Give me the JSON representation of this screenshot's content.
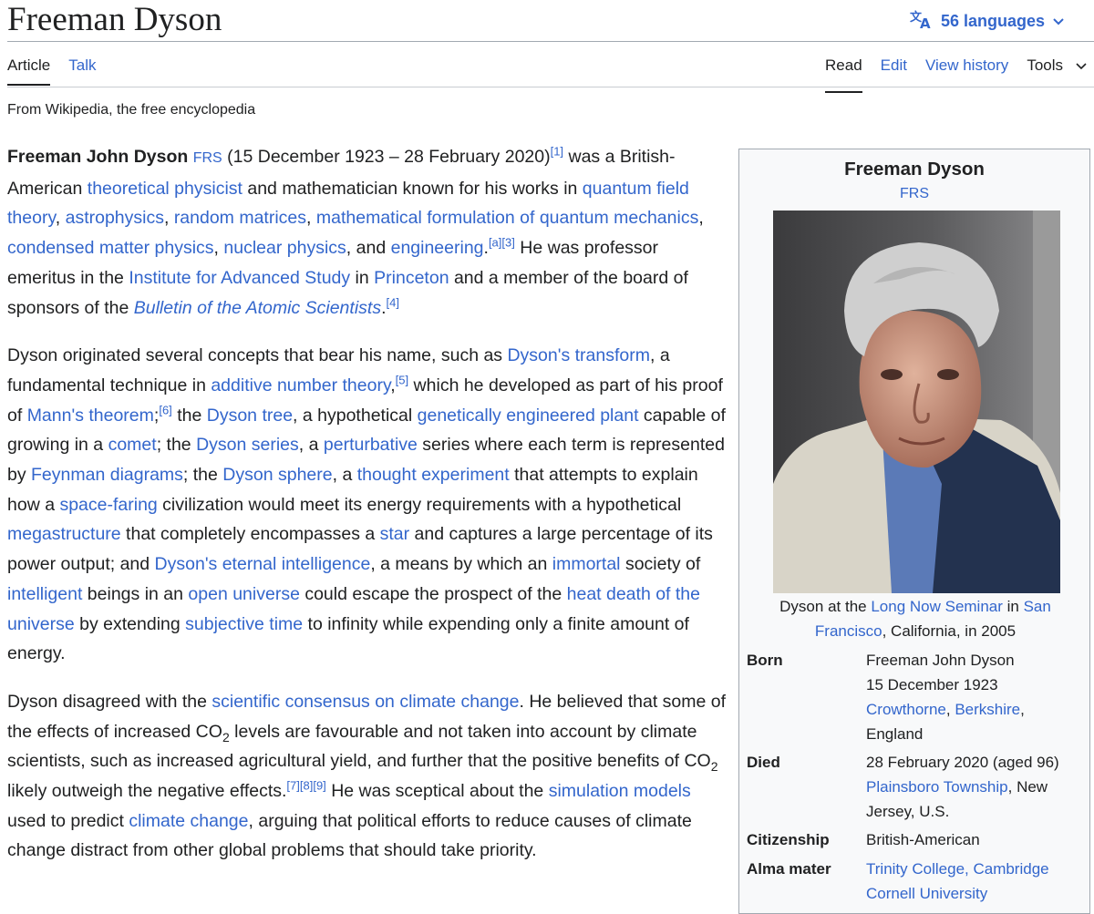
{
  "page": {
    "title": "Freeman Dyson",
    "languages_label": "56 languages",
    "tagline": "From Wikipedia, the free encyclopedia"
  },
  "tabs": {
    "article": "Article",
    "talk": "Talk",
    "read": "Read",
    "edit": "Edit",
    "view_history": "View history",
    "tools": "Tools"
  },
  "infobox": {
    "name": "Freeman Dyson",
    "post_nominal": "FRS",
    "caption": {
      "t1": "Dyson at the ",
      "l1": "Long Now Seminar",
      "t2": " in ",
      "l2": "San Francisco",
      "t3": ", California, in 2005"
    },
    "born": {
      "label": "Born",
      "name": "Freeman John Dyson",
      "date": "15 December 1923",
      "place1": "Crowthorne",
      "sep": ", ",
      "place2": "Berkshire",
      "place3": "England"
    },
    "died": {
      "label": "Died",
      "date": "28 February 2020 (aged 96)",
      "place1": "Plainsboro Township",
      "place1_rest": ", New Jersey, U.S."
    },
    "citizenship": {
      "label": "Citizenship",
      "value": "British-American"
    },
    "alma_mater": {
      "label": "Alma mater",
      "v1": "Trinity College, Cambridge",
      "v2": "Cornell University"
    }
  },
  "content": {
    "p1": [
      {
        "t": "Freeman John Dyson",
        "s": "b"
      },
      {
        "t": " "
      },
      {
        "t": "FRS",
        "s": "frs"
      },
      {
        "t": " (15 December 1923 – 28 February 2020)"
      },
      {
        "t": "[1]",
        "s": "sup"
      },
      {
        "t": " was a British-American "
      },
      {
        "t": "theoretical physicist",
        "s": "a"
      },
      {
        "t": " and mathematician known for his works in "
      },
      {
        "t": "quantum field theory",
        "s": "a"
      },
      {
        "t": ", "
      },
      {
        "t": "astrophysics",
        "s": "a"
      },
      {
        "t": ", "
      },
      {
        "t": "random matrices",
        "s": "a"
      },
      {
        "t": ", "
      },
      {
        "t": "mathematical formulation of quantum mechanics",
        "s": "a"
      },
      {
        "t": ", "
      },
      {
        "t": "condensed matter physics",
        "s": "a"
      },
      {
        "t": ", "
      },
      {
        "t": "nuclear physics",
        "s": "a"
      },
      {
        "t": ", and "
      },
      {
        "t": "engineering",
        "s": "a"
      },
      {
        "t": "."
      },
      {
        "t": "[a][3]",
        "s": "sup"
      },
      {
        "t": " He was professor emeritus in the "
      },
      {
        "t": "Institute for Advanced Study",
        "s": "a"
      },
      {
        "t": " in "
      },
      {
        "t": "Princeton",
        "s": "a"
      },
      {
        "t": " and a member of the board of sponsors of the "
      },
      {
        "t": "Bulletin of the Atomic Scientists",
        "s": "ai"
      },
      {
        "t": "."
      },
      {
        "t": "[4]",
        "s": "sup"
      }
    ],
    "p2": [
      {
        "t": "Dyson originated several concepts that bear his name, such as "
      },
      {
        "t": "Dyson's transform",
        "s": "a"
      },
      {
        "t": ", a fundamental technique in "
      },
      {
        "t": "additive number theory",
        "s": "a"
      },
      {
        "t": ","
      },
      {
        "t": "[5]",
        "s": "sup"
      },
      {
        "t": " which he developed as part of his proof of "
      },
      {
        "t": "Mann's theorem",
        "s": "a"
      },
      {
        "t": ";"
      },
      {
        "t": "[6]",
        "s": "sup"
      },
      {
        "t": " the "
      },
      {
        "t": "Dyson tree",
        "s": "a"
      },
      {
        "t": ", a hypothetical "
      },
      {
        "t": "genetically engineered plant",
        "s": "a"
      },
      {
        "t": " capable of growing in a "
      },
      {
        "t": "comet",
        "s": "a"
      },
      {
        "t": "; the "
      },
      {
        "t": "Dyson series",
        "s": "a"
      },
      {
        "t": ", a "
      },
      {
        "t": "perturbative",
        "s": "a"
      },
      {
        "t": " series where each term is represented by "
      },
      {
        "t": "Feynman diagrams",
        "s": "a"
      },
      {
        "t": "; the "
      },
      {
        "t": "Dyson sphere",
        "s": "a"
      },
      {
        "t": ", a "
      },
      {
        "t": "thought experiment",
        "s": "a"
      },
      {
        "t": " that attempts to explain how a "
      },
      {
        "t": "space-faring",
        "s": "a"
      },
      {
        "t": " civilization would meet its energy requirements with a hypothetical "
      },
      {
        "t": "megastructure",
        "s": "a"
      },
      {
        "t": " that completely encompasses a "
      },
      {
        "t": "star",
        "s": "a"
      },
      {
        "t": " and captures a large percentage of its power output; and "
      },
      {
        "t": "Dyson's eternal intelligence",
        "s": "a"
      },
      {
        "t": ", a means by which an "
      },
      {
        "t": "immortal",
        "s": "a"
      },
      {
        "t": " society of "
      },
      {
        "t": "intelligent",
        "s": "a"
      },
      {
        "t": " beings in an "
      },
      {
        "t": "open universe",
        "s": "a"
      },
      {
        "t": " could escape the prospect of the "
      },
      {
        "t": "heat death of the universe",
        "s": "a"
      },
      {
        "t": " by extending "
      },
      {
        "t": "subjective time",
        "s": "a"
      },
      {
        "t": " to infinity while expending only a finite amount of energy."
      }
    ],
    "p3": [
      {
        "t": "Dyson disagreed with the "
      },
      {
        "t": "scientific consensus on climate change",
        "s": "a"
      },
      {
        "t": ". He believed that some of the effects of increased CO"
      },
      {
        "t": "2",
        "s": "sub"
      },
      {
        "t": " levels are favourable and not taken into account by climate scientists, such as increased agricultural yield, and further that the positive benefits of CO"
      },
      {
        "t": "2",
        "s": "sub"
      },
      {
        "t": " likely outweigh the negative effects."
      },
      {
        "t": "[7][8][9]",
        "s": "sup"
      },
      {
        "t": " He was sceptical about the "
      },
      {
        "t": "simulation models",
        "s": "a"
      },
      {
        "t": " used to predict "
      },
      {
        "t": "climate change",
        "s": "a"
      },
      {
        "t": ", arguing that political efforts to reduce causes of climate change distract from other global problems that should take priority."
      }
    ]
  }
}
